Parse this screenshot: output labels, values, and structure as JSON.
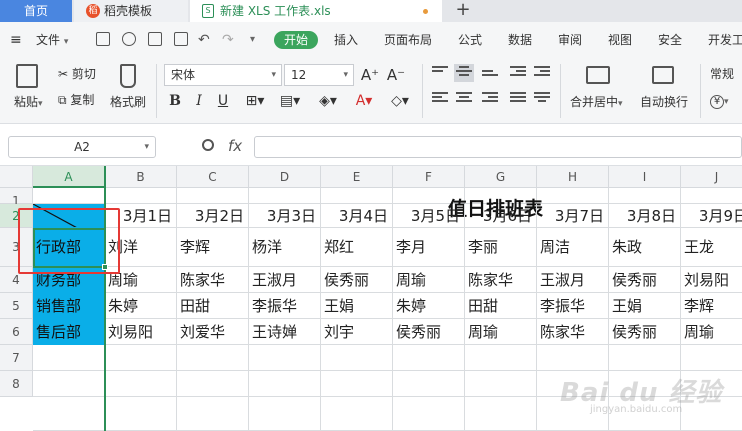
{
  "tabs": {
    "home": "首页",
    "template": "稻壳模板",
    "file": "新建 XLS 工作表.xls",
    "add": "+"
  },
  "menu": {
    "file": "文件",
    "items": [
      "开始",
      "插入",
      "页面布局",
      "公式",
      "数据",
      "审阅",
      "视图",
      "安全",
      "开发工"
    ]
  },
  "ribbon": {
    "paste": "粘贴",
    "cut": "剪切",
    "copy": "复制",
    "format_painter": "格式刷",
    "font_name": "宋体",
    "font_size": "12",
    "bold": "B",
    "italic": "I",
    "underline": "U",
    "merge": "合并居中",
    "wrap": "自动换行",
    "number_format": "常规",
    "currency": "¥"
  },
  "formula_bar": {
    "name_box": "A2",
    "fx": "fx",
    "formula": ""
  },
  "grid": {
    "columns": [
      "A",
      "B",
      "C",
      "D",
      "E",
      "F",
      "G",
      "H",
      "I",
      "J"
    ],
    "rows": [
      "1",
      "2",
      "3",
      "4",
      "5",
      "6",
      "7",
      "8"
    ],
    "title": "值日排班表",
    "dates": [
      "3月1日",
      "3月2日",
      "3月3日",
      "3月4日",
      "3月5日",
      "3月6日",
      "3月7日",
      "3月8日",
      "3月9日"
    ],
    "departments": [
      "行政部",
      "财务部",
      "销售部",
      "售后部"
    ],
    "schedule": [
      [
        "刘洋",
        "李辉",
        "杨洋",
        "郑红",
        "李月",
        "李丽",
        "周洁",
        "朱政",
        "王龙"
      ],
      [
        "周瑜",
        "陈家华",
        "王淑月",
        "侯秀丽",
        "周瑜",
        "陈家华",
        "王淑月",
        "侯秀丽",
        "刘易阳"
      ],
      [
        "朱婷",
        "田甜",
        "李振华",
        "王娟",
        "朱婷",
        "田甜",
        "李振华",
        "王娟",
        "李辉"
      ],
      [
        "刘易阳",
        "刘爱华",
        "王诗婵",
        "刘宇",
        "侯秀丽",
        "周瑜",
        "陈家华",
        "侯秀丽",
        "周瑜"
      ]
    ]
  },
  "colors": {
    "selection_fill": "#0aaee8",
    "accent_green": "#2c8f57",
    "highlight_red": "#e53935"
  },
  "watermark": {
    "brand": "Bai du 经验",
    "url": "jingyan.baidu.com"
  }
}
